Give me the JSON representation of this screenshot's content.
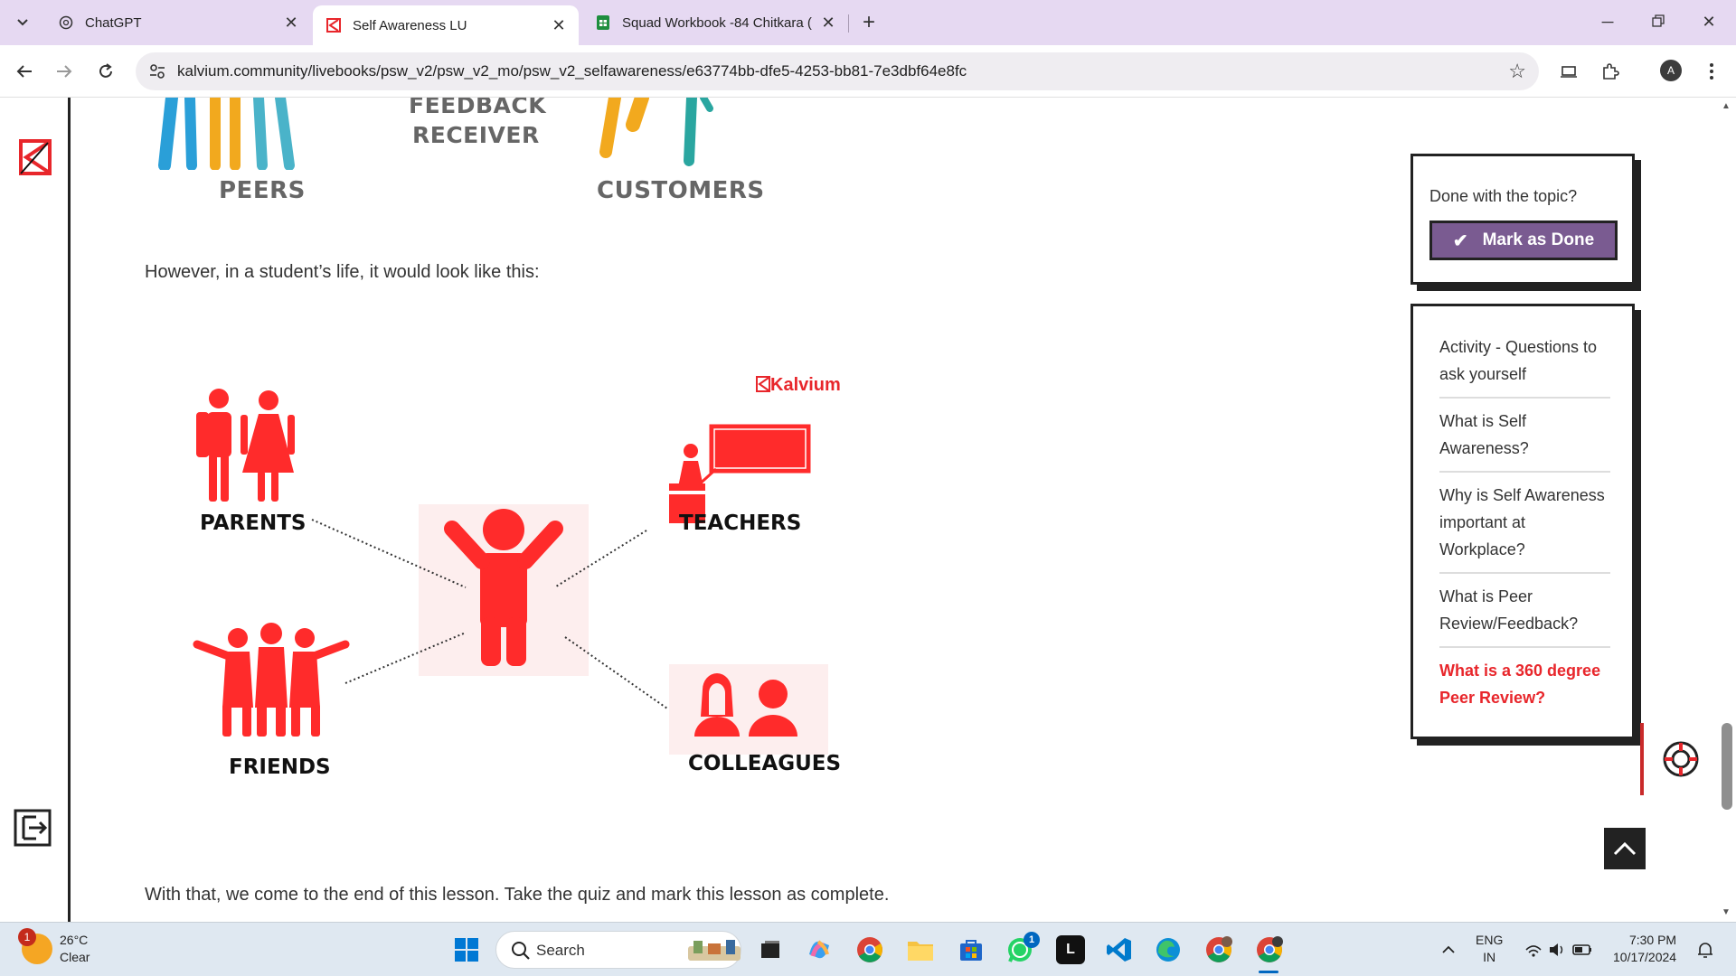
{
  "browser": {
    "tabs": [
      {
        "title": "ChatGPT",
        "icon": "chatgpt-icon"
      },
      {
        "title": "Self Awareness LU",
        "icon": "kalvium-icon",
        "active": true
      },
      {
        "title": "Squad Workbook -84 Chitkara (",
        "icon": "sheets-icon"
      }
    ],
    "url": "kalvium.community/livebooks/psw_v2/psw_v2_mo/psw_v2_selfawareness/e63774bb-dfe5-4253-bb81-7e3dbf64e8fc",
    "profile_initial": "A"
  },
  "lesson": {
    "top_labels": {
      "peers": "PEERS",
      "feedback": "FEEDBACK",
      "receiver": "RECEIVER",
      "customers": "CUSTOMERS"
    },
    "intro_text": "However, in a student’s life, it would look like this:",
    "diagram": {
      "brand": "Kalvium",
      "parents": "PARENTS",
      "teachers": "TEACHERS",
      "friends": "FRIENDS",
      "colleagues": "COLLEAGUES"
    },
    "outro_text": "With that, we come to the end of this lesson. Take the quiz and mark this lesson as complete."
  },
  "sidebar": {
    "done_question": "Done with the topic?",
    "mark_done_label": "Mark as Done",
    "toc": [
      {
        "line1": "Activity - Questions to",
        "line2": "ask yourself"
      },
      {
        "line1": "What is Self",
        "line2": "Awareness?"
      },
      {
        "line1": "Why is Self Awareness",
        "line2": "important at",
        "line3": "Workplace?"
      },
      {
        "line1": "What is Peer",
        "line2": "Review/Feedback?"
      },
      {
        "line1": "What is a 360 degree",
        "line2": "Peer Review?",
        "active": true
      }
    ]
  },
  "taskbar": {
    "weather_temp": "26°C",
    "weather_cond": "Clear",
    "weather_badge": "1",
    "search_label": "Search",
    "whatsapp_badge": "1",
    "lang_line1": "ENG",
    "lang_line2": "IN",
    "time": "7:30 PM",
    "date": "10/17/2024"
  },
  "colors": {
    "accent_red": "#e8262b",
    "button_purple": "#7a5b91",
    "tab_bar": "#e6d9f2"
  }
}
